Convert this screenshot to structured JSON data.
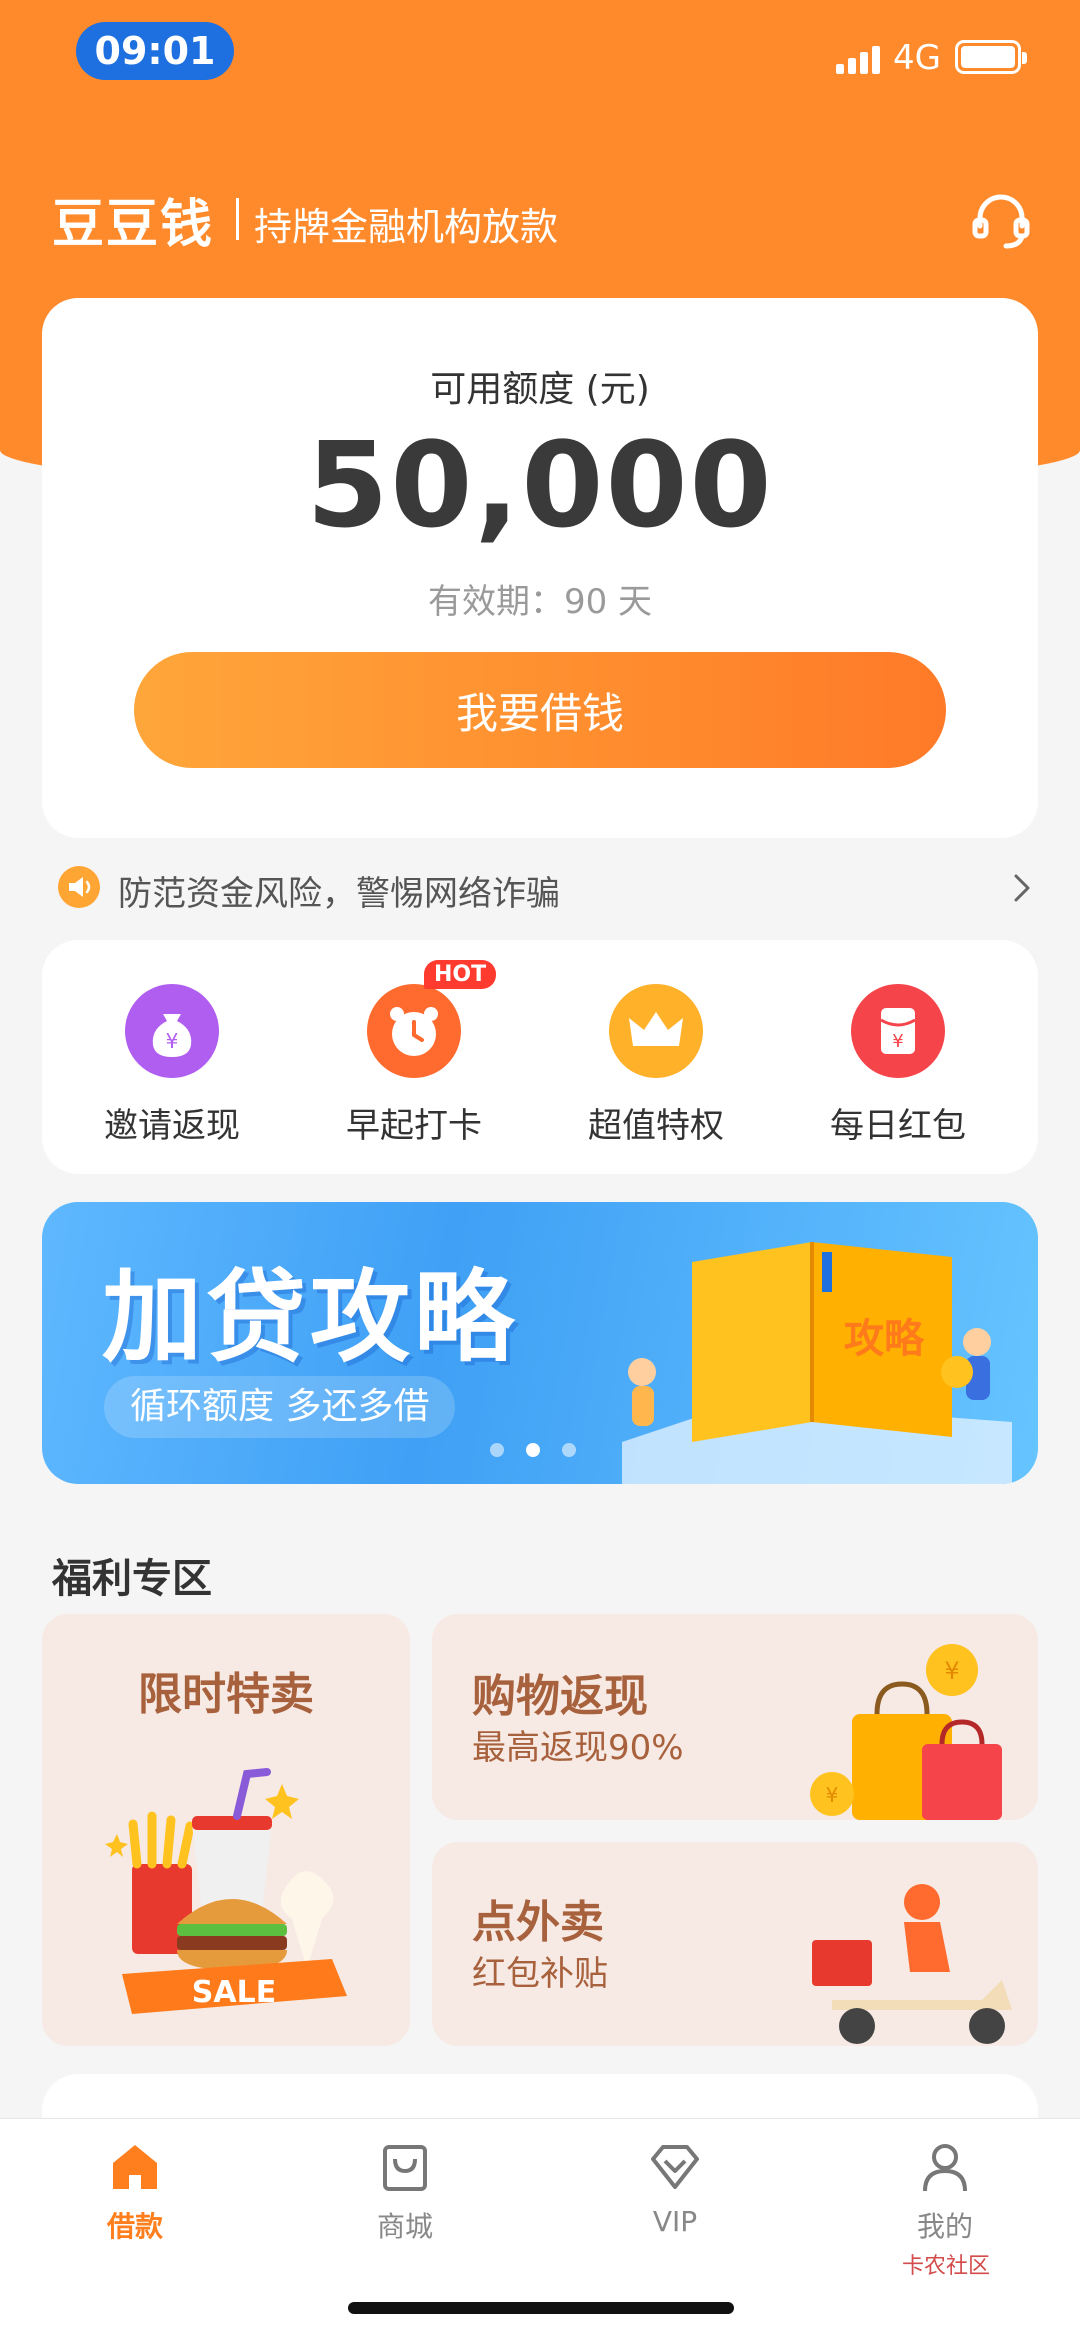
{
  "status_bar": {
    "time": "09:01",
    "network": "4G"
  },
  "header": {
    "brand": "豆豆钱",
    "slogan": "持牌金融机构放款"
  },
  "credit": {
    "label": "可用额度 (元)",
    "amount": "50,000",
    "validity": "有效期：90 天",
    "borrow_button": "我要借钱"
  },
  "notice": {
    "text": "防范资金风险，警惕网络诈骗"
  },
  "shortcuts": [
    {
      "label": "邀请返现",
      "icon": "money-bag-icon",
      "color": "#b05ef0"
    },
    {
      "label": "早起打卡",
      "icon": "alarm-clock-icon",
      "color": "#ff6a2e",
      "badge": "HOT"
    },
    {
      "label": "超值特权",
      "icon": "crown-icon",
      "color": "#ffb12a"
    },
    {
      "label": "每日红包",
      "icon": "red-envelope-icon",
      "color": "#f5444a"
    }
  ],
  "banner": {
    "title": "加贷攻略",
    "subtitle": "循环额度 多还多借",
    "book_text": "攻略",
    "slides": 3,
    "active_slide": 1
  },
  "welfare": {
    "title": "福利专区",
    "cards": [
      {
        "title": "限时特卖",
        "subtitle": "",
        "sale_tag": "SALE"
      },
      {
        "title": "购物返现",
        "subtitle": "最高返现90%"
      },
      {
        "title": "点外卖",
        "subtitle": "红包补贴"
      }
    ]
  },
  "tabs": [
    {
      "label": "借款",
      "icon": "home-icon",
      "active": true
    },
    {
      "label": "商城",
      "icon": "shopping-bag-icon",
      "active": false
    },
    {
      "label": "VIP",
      "icon": "diamond-icon",
      "active": false
    },
    {
      "label": "我的",
      "icon": "user-icon",
      "active": false
    }
  ],
  "watermark": "卡农社区",
  "colors": {
    "accent": "#ff8a2b",
    "status_pill": "#1e6fe0",
    "banner": "#3fa0f5",
    "promo_bg": "#f7e9e3",
    "promo_text": "#a8613d"
  }
}
